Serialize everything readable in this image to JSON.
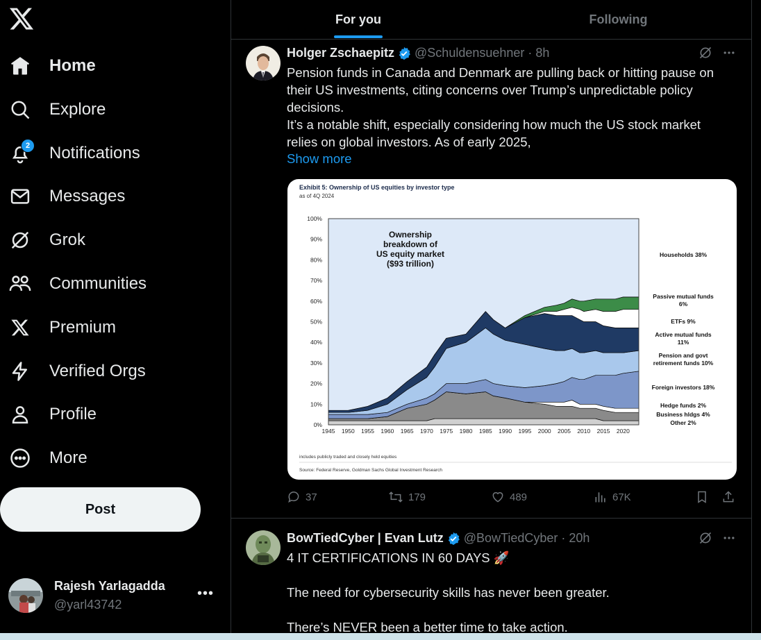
{
  "sidebar": {
    "items": [
      {
        "label": "Home",
        "icon": "home-icon",
        "active": true
      },
      {
        "label": "Explore",
        "icon": "search-icon"
      },
      {
        "label": "Notifications",
        "icon": "bell-icon",
        "badge": "2"
      },
      {
        "label": "Messages",
        "icon": "envelope-icon"
      },
      {
        "label": "Grok",
        "icon": "grok-icon"
      },
      {
        "label": "Communities",
        "icon": "people-icon"
      },
      {
        "label": "Premium",
        "icon": "x-logo-icon"
      },
      {
        "label": "Verified Orgs",
        "icon": "lightning-icon"
      },
      {
        "label": "Profile",
        "icon": "person-icon"
      },
      {
        "label": "More",
        "icon": "more-circle-icon"
      }
    ],
    "post_label": "Post",
    "user": {
      "name": "Rajesh Yarlagadda",
      "handle": "@yarl43742",
      "more": "•••"
    }
  },
  "tabs": [
    {
      "label": "For you",
      "active": true
    },
    {
      "label": "Following",
      "active": false
    }
  ],
  "tweets": [
    {
      "name": "Holger Zschaepitz",
      "handle": "@Schuldensuehner · 8h",
      "text": [
        "Pension funds in Canada and Denmark are pulling back or hitting pause on",
        "their US investments, citing concerns over Trump’s unpredictable policy",
        "decisions.",
        "It’s a notable shift, especially considering how much the US stock market",
        "relies on global investors. As of early 2025,"
      ],
      "show_more": "Show more",
      "actions": {
        "replies": "37",
        "reposts": "179",
        "likes": "489",
        "views": "67K"
      }
    },
    {
      "name": "BowTiedCyber | Evan Lutz",
      "handle": "@BowTiedCyber · 20h",
      "text": [
        "4 IT CERTIFICATIONS IN 60 DAYS 🚀",
        "",
        "The need for cybersecurity skills has never been greater.",
        "",
        "There’s NEVER been a better time to take action."
      ]
    }
  ],
  "chart_card": {
    "title": "Exhibit 5: Ownership of US equities by investor type",
    "subtitle": "as of 4Q 2024",
    "center_label": [
      "Ownership",
      "breakdown  of",
      "US equity market",
      "($93 trillion)"
    ],
    "footnote": "includes publicly traded and closely held equities",
    "source": "Source: Federal Reserve, Goldman Sachs Global Investment Research"
  },
  "chart_data": {
    "type": "area",
    "title": "Exhibit 5: Ownership of US equities by investor type",
    "subtitle": "as of 4Q 2024",
    "x_ticks": [
      "1945",
      "1950",
      "1955",
      "1960",
      "1965",
      "1970",
      "1975",
      "1980",
      "1985",
      "1990",
      "1995",
      "2000",
      "2005",
      "2010",
      "2015",
      "2020"
    ],
    "y_ticks": [
      "0%",
      "10%",
      "20%",
      "30%",
      "40%",
      "50%",
      "60%",
      "70%",
      "80%",
      "90%",
      "100%"
    ],
    "ylim": [
      0,
      100
    ],
    "xlim": [
      1945,
      2024
    ],
    "x": [
      1945,
      1950,
      1955,
      1960,
      1965,
      1970,
      1972,
      1975,
      1980,
      1985,
      1987,
      1990,
      1995,
      2000,
      2003,
      2005,
      2007,
      2009,
      2010,
      2013,
      2015,
      2018,
      2020,
      2024
    ],
    "series": [
      {
        "name": "Other",
        "label": "Other 2%",
        "color": "#d0d0d0",
        "values": [
          2,
          2,
          2,
          2,
          2,
          2,
          3,
          3,
          3,
          3,
          3,
          3,
          3,
          3,
          3,
          3,
          3,
          3,
          3,
          3,
          2,
          2,
          2,
          2
        ]
      },
      {
        "name": "Business hldgs",
        "label": "Business hldgs 4%",
        "color": "#8a8a8a",
        "values": [
          1,
          1,
          1,
          2,
          6,
          8,
          9,
          13,
          12,
          13,
          11,
          10,
          8,
          7,
          6,
          6,
          6,
          5,
          5,
          5,
          5,
          4,
          4,
          4
        ]
      },
      {
        "name": "Hedge funds",
        "label": "Hedge funds 2%",
        "color": "#ffffff",
        "values": [
          0,
          0,
          0,
          0,
          0,
          0,
          0,
          0,
          0,
          0,
          0,
          0,
          0,
          1,
          2,
          2,
          3,
          2,
          2,
          2,
          2,
          2,
          2,
          2
        ]
      },
      {
        "name": "Foreign investors",
        "label": "Foreign investors 18%",
        "color": "#7d96c9",
        "values": [
          2,
          2,
          2,
          2,
          2,
          3,
          3,
          4,
          5,
          6,
          6,
          6,
          7,
          8,
          9,
          10,
          11,
          12,
          12,
          14,
          15,
          16,
          17,
          18
        ]
      },
      {
        "name": "Pension and govt retirement funds",
        "label": "Pension and govt retirement funds 10%",
        "color": "#a9c8ec",
        "values": [
          1,
          1,
          2,
          4,
          7,
          10,
          13,
          17,
          20,
          25,
          24,
          22,
          21,
          18,
          16,
          15,
          14,
          13,
          13,
          12,
          11,
          11,
          10,
          10
        ]
      },
      {
        "name": "Active mutual funds",
        "label": "Active mutual funds 11%",
        "color": "#1f3a64",
        "values": [
          1,
          1,
          2,
          3,
          4,
          5,
          6,
          5,
          4,
          8,
          7,
          6,
          13,
          17,
          17,
          17,
          16,
          16,
          15,
          14,
          13,
          12,
          12,
          11
        ]
      },
      {
        "name": "ETFs",
        "label": "ETFs 9%",
        "color": "#ffffff",
        "values": [
          0,
          0,
          0,
          0,
          0,
          0,
          0,
          0,
          0,
          0,
          0,
          0,
          0,
          1,
          2,
          3,
          4,
          5,
          5,
          6,
          7,
          8,
          9,
          9
        ]
      },
      {
        "name": "Passive mutual funds",
        "label": "Passive mutual funds 6%",
        "color": "#3c8c48",
        "values": [
          0,
          0,
          0,
          0,
          0,
          0,
          0,
          0,
          0,
          0,
          0,
          0,
          1,
          2,
          3,
          3,
          4,
          4,
          5,
          5,
          6,
          6,
          6,
          6
        ]
      },
      {
        "name": "Households",
        "label": "Households 38%",
        "color": "#dde9f8",
        "values": [
          93,
          93,
          91,
          87,
          79,
          72,
          66,
          58,
          56,
          45,
          49,
          53,
          47,
          43,
          42,
          41,
          39,
          40,
          40,
          39,
          39,
          39,
          38,
          38
        ]
      }
    ],
    "legend_placement": "right",
    "grid": false
  }
}
